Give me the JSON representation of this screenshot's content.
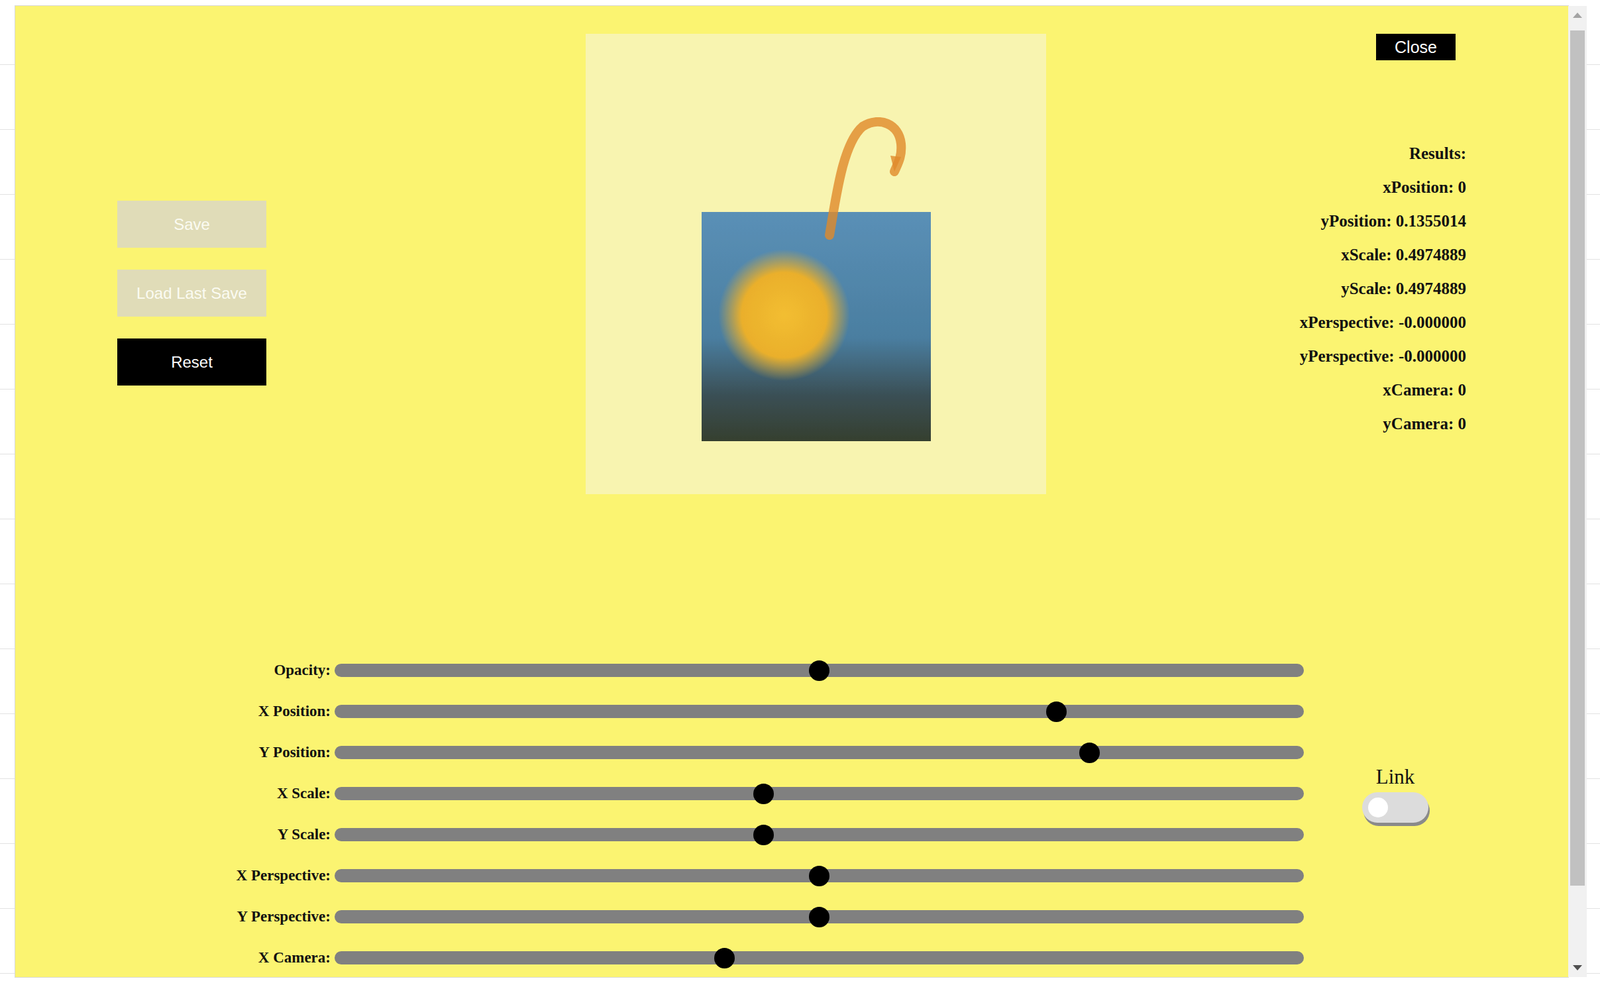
{
  "dialog": {
    "close": "Close"
  },
  "buttons": [
    {
      "label": "Save",
      "disabled": true
    },
    {
      "label": "Load Last Save",
      "disabled": true
    },
    {
      "label": "Reset",
      "disabled": false
    }
  ],
  "results": {
    "title": "Results:",
    "lines": [
      "xPosition: 0",
      "yPosition: 0.1355014",
      "xScale: 0.4974889",
      "yScale: 0.4974889",
      "xPerspective: -0.000000",
      "yPerspective: -0.000000",
      "xCamera: 0",
      "yCamera: 0"
    ]
  },
  "sliders": [
    {
      "label": "Opacity:",
      "level": 0.5
    },
    {
      "label": "X Position:",
      "level": 0.75
    },
    {
      "label": "Y Position:",
      "level": 0.785
    },
    {
      "label": "X Scale:",
      "level": 0.441
    },
    {
      "label": "Y Scale:",
      "level": 0.441
    },
    {
      "label": "X Perspective:",
      "level": 0.5
    },
    {
      "label": "Y Perspective:",
      "level": 0.5
    },
    {
      "label": "X Camera:",
      "level": 0.4
    }
  ],
  "link": {
    "label": "Link",
    "on": false
  }
}
